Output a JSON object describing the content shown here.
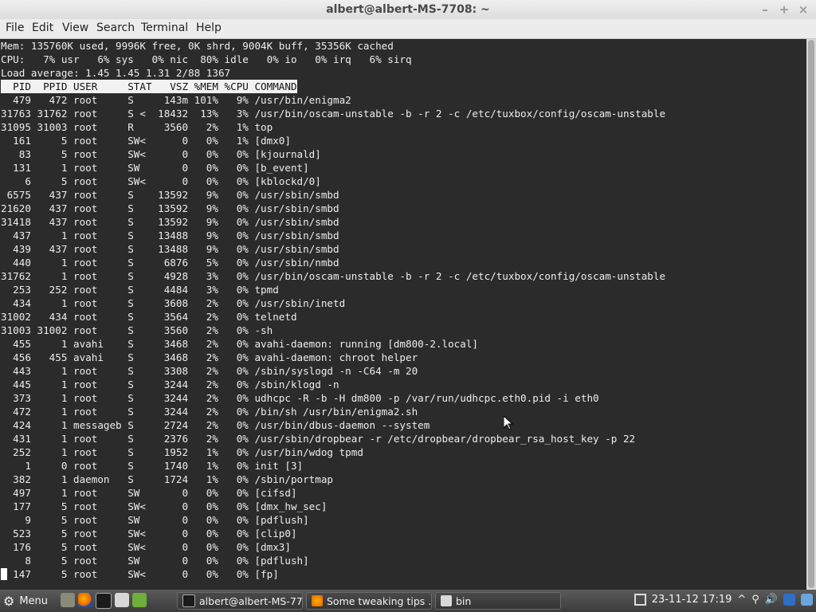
{
  "window": {
    "title": "albert@albert-MS-7708: ~",
    "controls": [
      "–",
      "+",
      "×"
    ]
  },
  "menu": [
    "File",
    "Edit",
    "View",
    "Search",
    "Terminal",
    "Help"
  ],
  "terminal": {
    "lines": [
      "Mem: 135760K used, 9996K free, 0K shrd, 9004K buff, 35356K cached",
      "CPU:   7% usr   6% sys   0% nic  80% idle   0% io   0% irq   6% sirq",
      "Load average: 1.45 1.45 1.31 2/88 1367",
      "  PID  PPID USER     STAT   VSZ %MEM %CPU COMMAND",
      "  479   472 root     S     143m 101%   9% /usr/bin/enigma2",
      "31763 31762 root     S <  18432  13%   3% /usr/bin/oscam-unstable -b -r 2 -c /etc/tuxbox/config/oscam-unstable",
      "31095 31003 root     R     3560   2%   1% top",
      "  161     5 root     SW<      0   0%   1% [dmx0]",
      "   83     5 root     SW<      0   0%   0% [kjournald]",
      "  131     1 root     SW       0   0%   0% [b_event]",
      "    6     5 root     SW<      0   0%   0% [kblockd/0]",
      " 6575   437 root     S    13592   9%   0% /usr/sbin/smbd",
      "21620   437 root     S    13592   9%   0% /usr/sbin/smbd",
      "31418   437 root     S    13592   9%   0% /usr/sbin/smbd",
      "  437     1 root     S    13488   9%   0% /usr/sbin/smbd",
      "  439   437 root     S    13488   9%   0% /usr/sbin/smbd",
      "  440     1 root     S     6876   5%   0% /usr/sbin/nmbd",
      "31762     1 root     S     4928   3%   0% /usr/bin/oscam-unstable -b -r 2 -c /etc/tuxbox/config/oscam-unstable",
      "  253   252 root     S     4484   3%   0% tpmd",
      "  434     1 root     S     3608   2%   0% /usr/sbin/inetd",
      "31002   434 root     S     3564   2%   0% telnetd",
      "31003 31002 root     S     3560   2%   0% -sh",
      "  455     1 avahi    S     3468   2%   0% avahi-daemon: running [dm800-2.local]",
      "  456   455 avahi    S     3468   2%   0% avahi-daemon: chroot helper",
      "  443     1 root     S     3308   2%   0% /sbin/syslogd -n -C64 -m 20",
      "  445     1 root     S     3244   2%   0% /sbin/klogd -n",
      "  373     1 root     S     3244   2%   0% udhcpc -R -b -H dm800 -p /var/run/udhcpc.eth0.pid -i eth0",
      "  472     1 root     S     3244   2%   0% /bin/sh /usr/bin/enigma2.sh",
      "  424     1 messageb S     2724   2%   0% /usr/bin/dbus-daemon --system",
      "  431     1 root     S     2376   2%   0% /usr/sbin/dropbear -r /etc/dropbear/dropbear_rsa_host_key -p 22",
      "  252     1 root     S     1952   1%   0% /usr/bin/wdog tpmd",
      "    1     0 root     S     1740   1%   0% init [3]",
      "  382     1 daemon   S     1724   1%   0% /sbin/portmap",
      "  497     1 root     SW       0   0%   0% [cifsd]",
      "  177     5 root     SW<      0   0%   0% [dmx_hw_sec]",
      "    9     5 root     SW       0   0%   0% [pdflush]",
      "  523     5 root     SW<      0   0%   0% [clip0]",
      "  176     5 root     SW<      0   0%   0% [dmx3]",
      "    8     5 root     SW       0   0%   0% [pdflush]",
      "  147     5 root     SW<      0   0%   0% [fp]"
    ],
    "header_line_index": 3
  },
  "taskbar": {
    "menu_label": "Menu",
    "tasks": [
      "albert@albert-MS-77...",
      "Some tweaking tips ...",
      "bin"
    ],
    "clock": "23-11-12 17:19"
  },
  "colors": {
    "terminal_bg": "#2b2b2b",
    "terminal_fg": "#ededed",
    "header_bg": "#f2f2f2",
    "panel": "#3c3c3c",
    "firefox": "#e66000"
  },
  "icons": [
    "menu-gear-icon",
    "files-icon",
    "firefox-icon",
    "terminal-icon",
    "text-editor-icon",
    "settings-icon",
    "network-icon",
    "sound-icon",
    "shield-icon"
  ]
}
